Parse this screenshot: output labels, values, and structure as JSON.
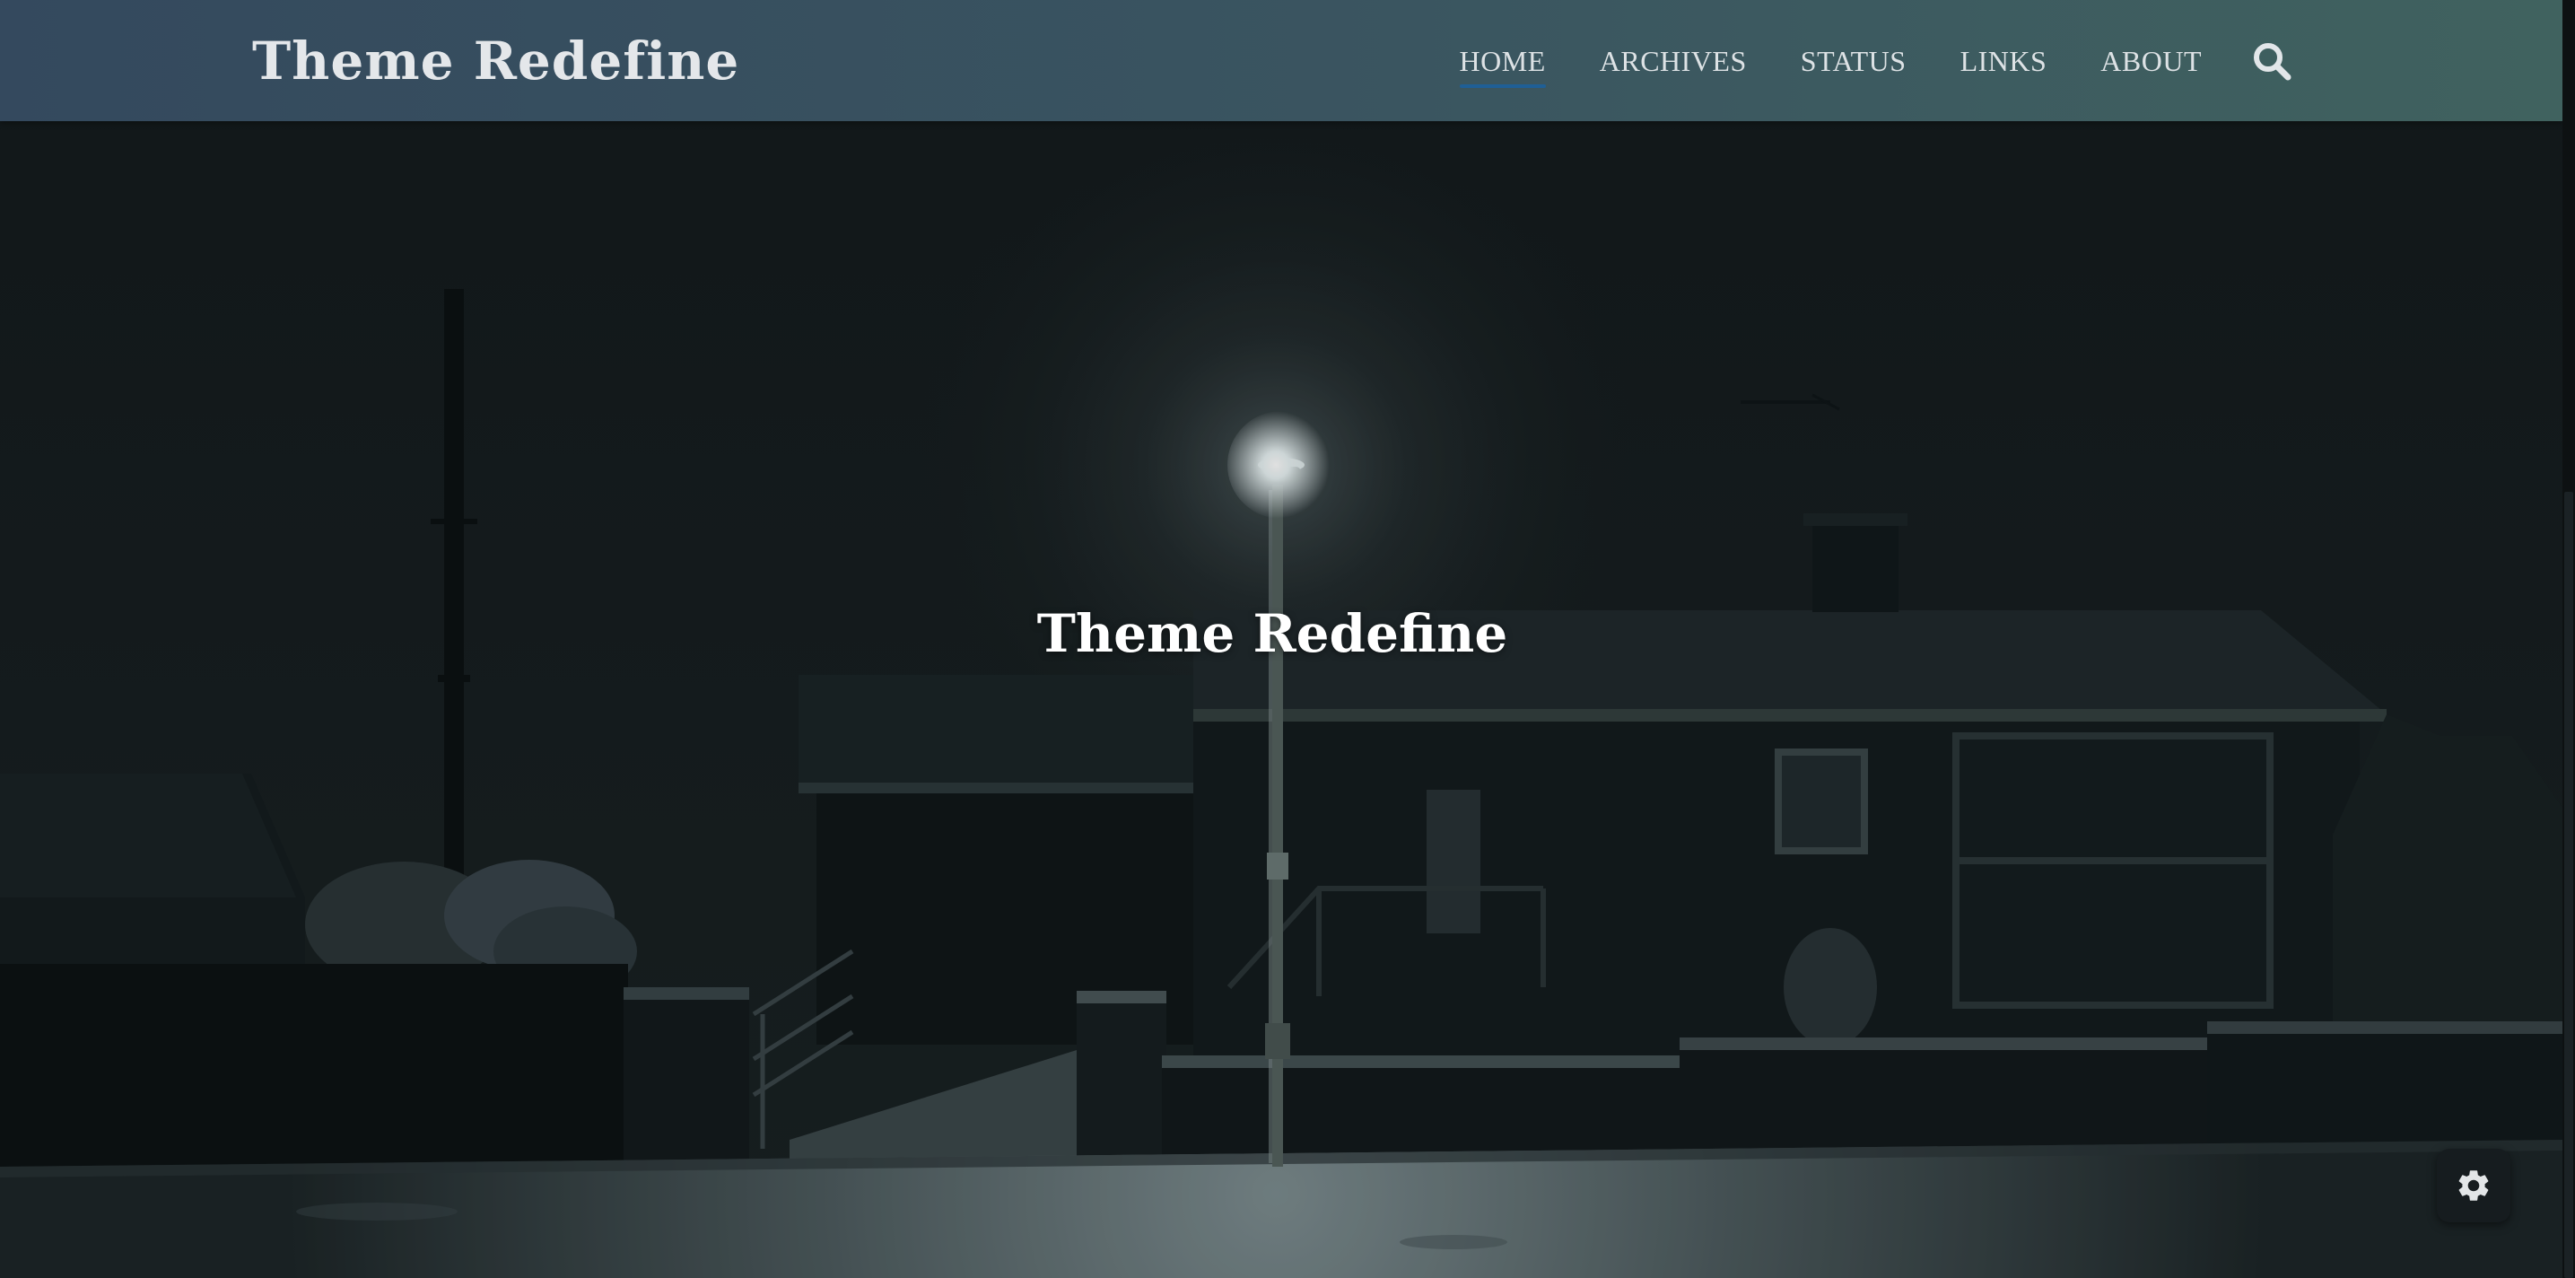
{
  "site": {
    "logo_text": "Theme Redefine",
    "hero_title": "Theme Redefine"
  },
  "nav": {
    "items": [
      {
        "label": "HOME",
        "active": true
      },
      {
        "label": "ARCHIVES",
        "active": false
      },
      {
        "label": "STATUS",
        "active": false
      },
      {
        "label": "LINKS",
        "active": false
      },
      {
        "label": "ABOUT",
        "active": false
      }
    ],
    "search_icon": "search-icon"
  },
  "settings": {
    "icon": "gear-icon"
  },
  "colors": {
    "header_start": "#34495e",
    "header_end": "#40625f",
    "active_underline": "#1f5f96",
    "nav_text": "#dde2e5"
  }
}
